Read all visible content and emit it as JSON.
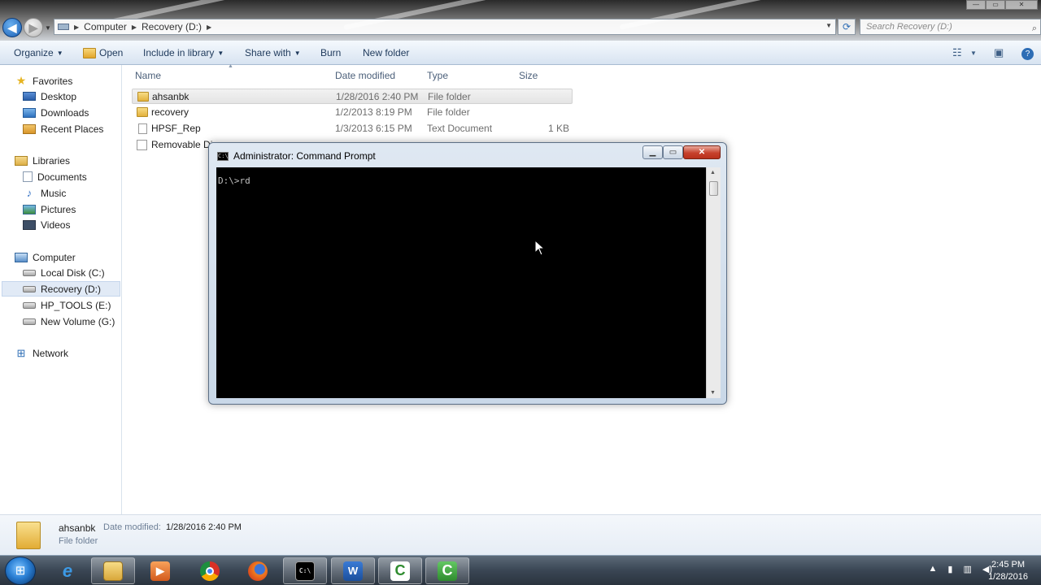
{
  "address": {
    "crumbs": [
      "Computer",
      "Recovery (D:)"
    ],
    "search_placeholder": "Search Recovery (D:)"
  },
  "toolbar": {
    "organize": "Organize",
    "open": "Open",
    "include_in_library": "Include in library",
    "share_with": "Share with",
    "burn": "Burn",
    "new_folder": "New folder"
  },
  "nav": {
    "favorites": "Favorites",
    "desktop": "Desktop",
    "downloads": "Downloads",
    "recent_places": "Recent Places",
    "libraries": "Libraries",
    "documents": "Documents",
    "music": "Music",
    "pictures": "Pictures",
    "videos": "Videos",
    "computer": "Computer",
    "local_disk": "Local Disk (C:)",
    "recovery": "Recovery (D:)",
    "hp_tools": "HP_TOOLS (E:)",
    "new_volume": "New Volume (G:)",
    "network": "Network"
  },
  "columns": {
    "name": "Name",
    "date_modified": "Date modified",
    "type": "Type",
    "size": "Size"
  },
  "files": [
    {
      "name": "ahsanbk",
      "date": "1/28/2016 2:40 PM",
      "type": "File folder",
      "size": ""
    },
    {
      "name": "recovery",
      "date": "1/2/2013 8:19 PM",
      "type": "File folder",
      "size": ""
    },
    {
      "name": "HPSF_Rep",
      "date": "1/3/2013 6:15 PM",
      "type": "Text Document",
      "size": "1 KB"
    },
    {
      "name": "Removable Di",
      "date": "",
      "type": "",
      "size": ""
    }
  ],
  "cmd": {
    "title": "Administrator: Command Prompt",
    "line": "D:\\>rd"
  },
  "details": {
    "name": "ahsanbk",
    "date_label": "Date modified:",
    "date_value": "1/28/2016 2:40 PM",
    "type": "File folder"
  },
  "clock": {
    "time": "2:45 PM",
    "date": "1/28/2016"
  },
  "colors": {
    "accent": "#1a5fb4",
    "console_bg": "#000000",
    "console_fg": "#c0c0c0",
    "close_button": "#c7412c"
  }
}
